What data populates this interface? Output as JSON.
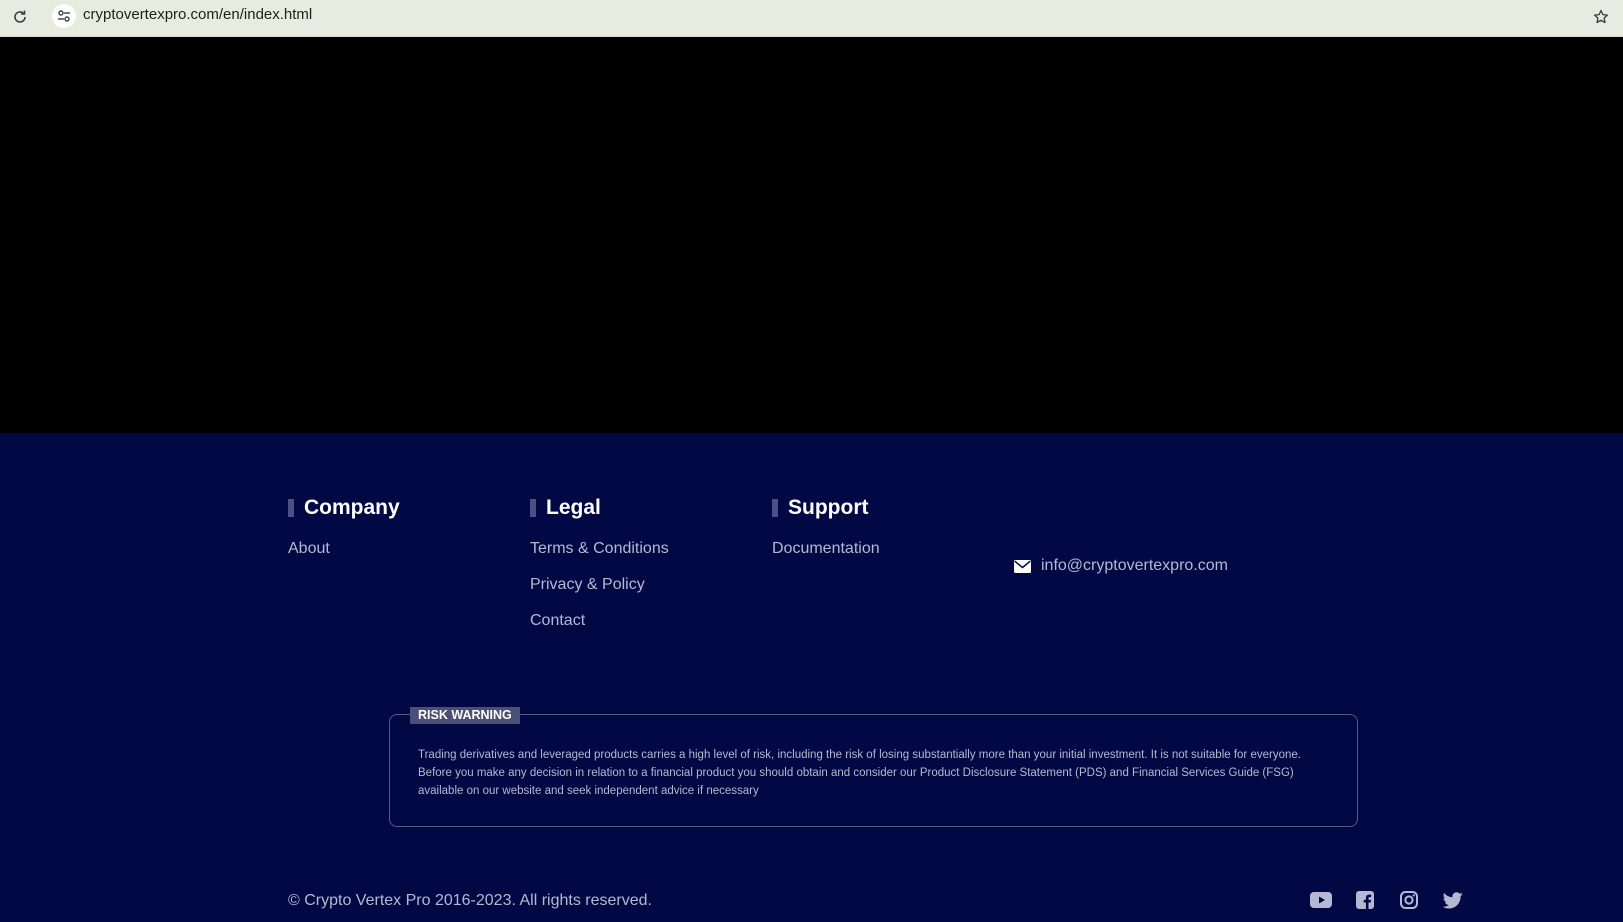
{
  "browser": {
    "url": "cryptovertexpro.com/en/index.html"
  },
  "footer": {
    "columns": [
      {
        "title": "Company",
        "links": [
          "About"
        ]
      },
      {
        "title": "Legal",
        "links": [
          "Terms & Conditions",
          "Privacy & Policy",
          "Contact"
        ]
      },
      {
        "title": "Support",
        "links": [
          "Documentation"
        ]
      }
    ],
    "email": "info@cryptovertexpro.com",
    "risk_label": "RISK WARNING",
    "risk_text": "Trading derivatives and leveraged products carries a high level of risk, including the risk of losing substantially more than your initial investment. It is not suitable for everyone. Before you make any decision in relation to a financial product you should obtain and consider our Product Disclosure Statement (PDS) and Financial Services Guide (FSG) available on our website and seek independent advice if necessary",
    "copyright": "© Crypto Vertex Pro 2016-2023. All rights reserved.",
    "socials": [
      "youtube-icon",
      "facebook-icon",
      "instagram-icon",
      "twitter-icon"
    ]
  },
  "colors": {
    "footer_bg": "#020843",
    "accent_bar": "#4a4f84",
    "link": "#b4b8d2"
  }
}
